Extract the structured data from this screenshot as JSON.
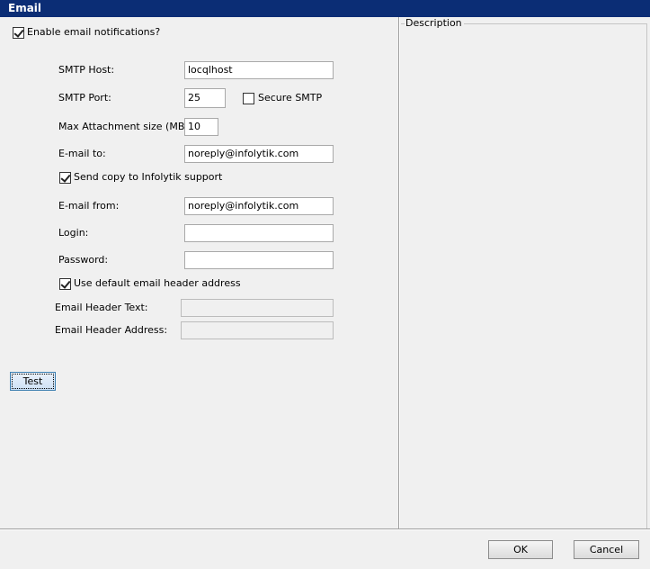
{
  "window": {
    "title": "Email"
  },
  "enable_notifications": {
    "label": "Enable email notifications?",
    "checked": true
  },
  "smtp_host": {
    "label": "SMTP Host:",
    "value": "locqlhost"
  },
  "smtp_port": {
    "label": "SMTP Port:",
    "value": "25"
  },
  "secure_smtp": {
    "label": "Secure SMTP",
    "checked": false
  },
  "max_attachment": {
    "label": "Max Attachment size (MB):",
    "value": "10"
  },
  "email_to": {
    "label": "E-mail to:",
    "value": "noreply@infolytik.com"
  },
  "send_copy": {
    "label": "Send copy to Infolytik support",
    "checked": true
  },
  "email_from": {
    "label": "E-mail from:",
    "value": "noreply@infolytik.com"
  },
  "login": {
    "label": "Login:",
    "value": ""
  },
  "password": {
    "label": "Password:",
    "value": ""
  },
  "use_default_header": {
    "label": "Use default email header address",
    "checked": true
  },
  "header_text": {
    "label": "Email Header Text:",
    "value": "",
    "enabled": false
  },
  "header_address": {
    "label": "Email Header Address:",
    "value": "",
    "enabled": false
  },
  "test_button": {
    "label": "Test"
  },
  "description": {
    "label": "Description"
  },
  "footer": {
    "ok_label": "OK",
    "cancel_label": "Cancel"
  },
  "colors": {
    "titlebar": "#0b2d75",
    "background": "#f0f0f0",
    "focus_border": "#3c7fb1"
  }
}
